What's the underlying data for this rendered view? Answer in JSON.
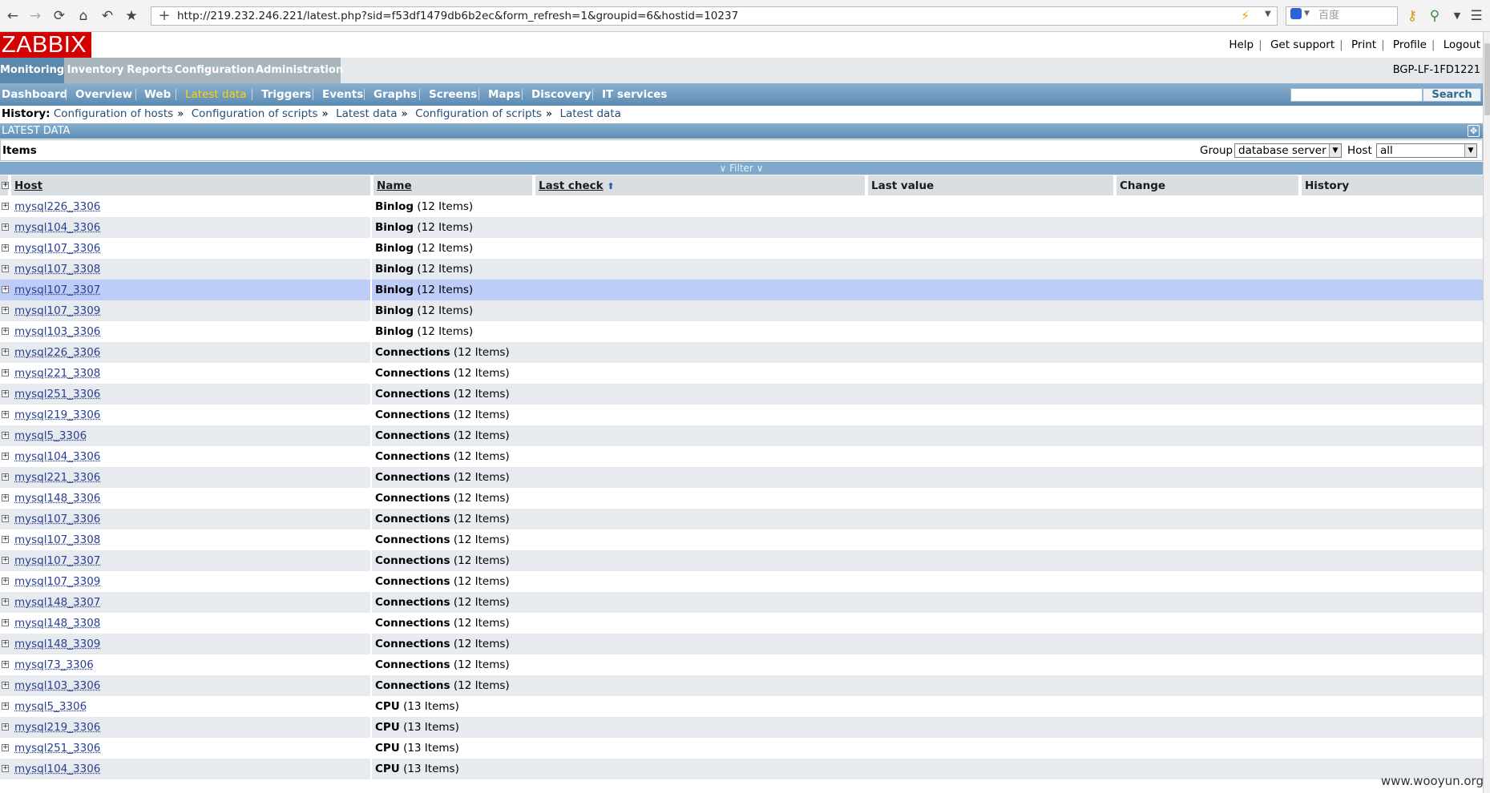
{
  "browser": {
    "url": "http://219.232.246.221/latest.php?sid=f53df1479db6b2ec&form_refresh=1&groupid=6&hostid=10237",
    "search_placeholder": "百度"
  },
  "header": {
    "logo": "ZABBIX",
    "links": [
      "Help",
      "Get support",
      "Print",
      "Profile",
      "Logout"
    ],
    "server": "BGP-LF-1FD1221"
  },
  "main_menu": [
    "Monitoring",
    "Inventory",
    "Reports",
    "Configuration",
    "Administration"
  ],
  "sub_menu": [
    "Dashboard",
    "Overview",
    "Web",
    "Latest data",
    "Triggers",
    "Events",
    "Graphs",
    "Screens",
    "Maps",
    "Discovery",
    "IT services"
  ],
  "sub_search_label": "Search",
  "history": {
    "label": "History:",
    "items": [
      "Configuration of hosts",
      "Configuration of scripts",
      "Latest data",
      "Configuration of scripts",
      "Latest data"
    ]
  },
  "section_title": "LATEST DATA",
  "items_title": "Items",
  "filter": {
    "group_label": "Group",
    "group_value": "database server",
    "host_label": "Host",
    "host_value": "all",
    "toggle_label": "Filter"
  },
  "table": {
    "columns": [
      "Host",
      "Name",
      "Last check",
      "Last value",
      "Change",
      "History"
    ],
    "rows": [
      {
        "host": "mysql226_3306",
        "name": "Binlog",
        "count": "(12 Items)"
      },
      {
        "host": "mysql104_3306",
        "name": "Binlog",
        "count": "(12 Items)"
      },
      {
        "host": "mysql107_3306",
        "name": "Binlog",
        "count": "(12 Items)"
      },
      {
        "host": "mysql107_3308",
        "name": "Binlog",
        "count": "(12 Items)"
      },
      {
        "host": "mysql107_3307",
        "name": "Binlog",
        "count": "(12 Items)"
      },
      {
        "host": "mysql107_3309",
        "name": "Binlog",
        "count": "(12 Items)"
      },
      {
        "host": "mysql103_3306",
        "name": "Binlog",
        "count": "(12 Items)"
      },
      {
        "host": "mysql226_3306",
        "name": "Connections",
        "count": "(12 Items)"
      },
      {
        "host": "mysql221_3308",
        "name": "Connections",
        "count": "(12 Items)"
      },
      {
        "host": "mysql251_3306",
        "name": "Connections",
        "count": "(12 Items)"
      },
      {
        "host": "mysql219_3306",
        "name": "Connections",
        "count": "(12 Items)"
      },
      {
        "host": "mysql5_3306",
        "name": "Connections",
        "count": "(12 Items)"
      },
      {
        "host": "mysql104_3306",
        "name": "Connections",
        "count": "(12 Items)"
      },
      {
        "host": "mysql221_3306",
        "name": "Connections",
        "count": "(12 Items)"
      },
      {
        "host": "mysql148_3306",
        "name": "Connections",
        "count": "(12 Items)"
      },
      {
        "host": "mysql107_3306",
        "name": "Connections",
        "count": "(12 Items)"
      },
      {
        "host": "mysql107_3308",
        "name": "Connections",
        "count": "(12 Items)"
      },
      {
        "host": "mysql107_3307",
        "name": "Connections",
        "count": "(12 Items)"
      },
      {
        "host": "mysql107_3309",
        "name": "Connections",
        "count": "(12 Items)"
      },
      {
        "host": "mysql148_3307",
        "name": "Connections",
        "count": "(12 Items)"
      },
      {
        "host": "mysql148_3308",
        "name": "Connections",
        "count": "(12 Items)"
      },
      {
        "host": "mysql148_3309",
        "name": "Connections",
        "count": "(12 Items)"
      },
      {
        "host": "mysql73_3306",
        "name": "Connections",
        "count": "(12 Items)"
      },
      {
        "host": "mysql103_3306",
        "name": "Connections",
        "count": "(12 Items)"
      },
      {
        "host": "mysql5_3306",
        "name": "CPU",
        "count": "(13 Items)"
      },
      {
        "host": "mysql219_3306",
        "name": "CPU",
        "count": "(13 Items)"
      },
      {
        "host": "mysql251_3306",
        "name": "CPU",
        "count": "(13 Items)"
      },
      {
        "host": "mysql104_3306",
        "name": "CPU",
        "count": "(13 Items)"
      }
    ]
  },
  "watermark": "www.wooyun.org"
}
